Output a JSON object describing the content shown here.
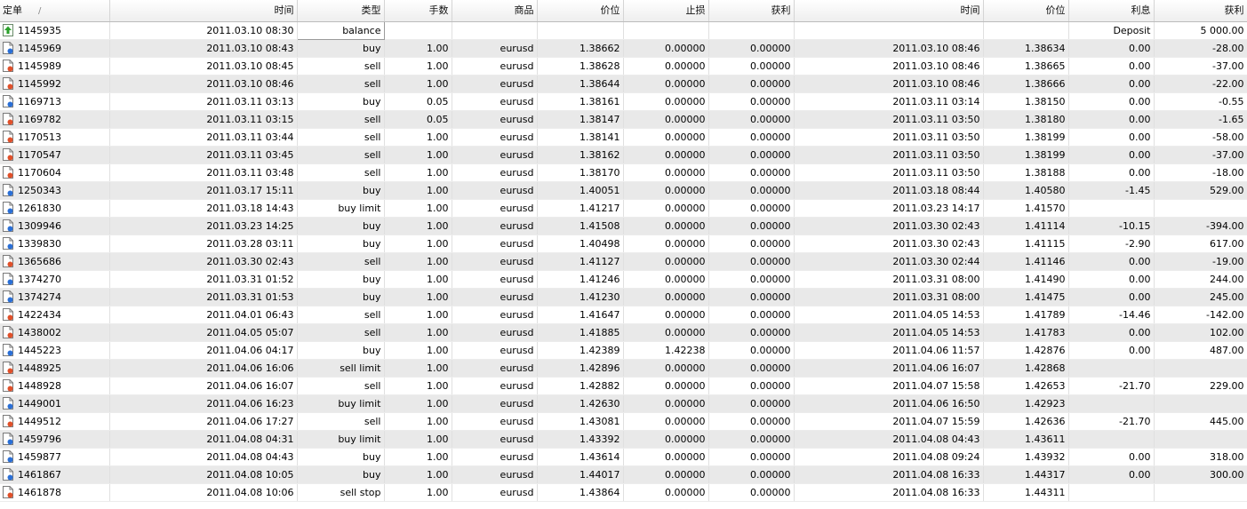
{
  "columns": [
    "定单",
    "时间",
    "类型",
    "手数",
    "商品",
    "价位",
    "止损",
    "获利",
    "时间",
    "价位",
    "利息",
    "获利"
  ],
  "sort_indicator": "/",
  "balance_row": {
    "order": "1145935",
    "time": "2011.03.10 08:30",
    "type": "balance",
    "comment": "Deposit",
    "amount": "5 000.00"
  },
  "rows": [
    {
      "order": "1145969",
      "open_time": "2011.03.10 08:43",
      "type": "buy",
      "lots": "1.00",
      "symbol": "eurusd",
      "open_price": "1.38662",
      "sl": "0.00000",
      "tp": "0.00000",
      "close_time": "2011.03.10 08:46",
      "close_price": "1.38634",
      "swap": "0.00",
      "profit": "-28.00",
      "icon": "buy"
    },
    {
      "order": "1145989",
      "open_time": "2011.03.10 08:45",
      "type": "sell",
      "lots": "1.00",
      "symbol": "eurusd",
      "open_price": "1.38628",
      "sl": "0.00000",
      "tp": "0.00000",
      "close_time": "2011.03.10 08:46",
      "close_price": "1.38665",
      "swap": "0.00",
      "profit": "-37.00",
      "icon": "sell"
    },
    {
      "order": "1145992",
      "open_time": "2011.03.10 08:46",
      "type": "sell",
      "lots": "1.00",
      "symbol": "eurusd",
      "open_price": "1.38644",
      "sl": "0.00000",
      "tp": "0.00000",
      "close_time": "2011.03.10 08:46",
      "close_price": "1.38666",
      "swap": "0.00",
      "profit": "-22.00",
      "icon": "sell"
    },
    {
      "order": "1169713",
      "open_time": "2011.03.11 03:13",
      "type": "buy",
      "lots": "0.05",
      "symbol": "eurusd",
      "open_price": "1.38161",
      "sl": "0.00000",
      "tp": "0.00000",
      "close_time": "2011.03.11 03:14",
      "close_price": "1.38150",
      "swap": "0.00",
      "profit": "-0.55",
      "icon": "buy"
    },
    {
      "order": "1169782",
      "open_time": "2011.03.11 03:15",
      "type": "sell",
      "lots": "0.05",
      "symbol": "eurusd",
      "open_price": "1.38147",
      "sl": "0.00000",
      "tp": "0.00000",
      "close_time": "2011.03.11 03:50",
      "close_price": "1.38180",
      "swap": "0.00",
      "profit": "-1.65",
      "icon": "sell"
    },
    {
      "order": "1170513",
      "open_time": "2011.03.11 03:44",
      "type": "sell",
      "lots": "1.00",
      "symbol": "eurusd",
      "open_price": "1.38141",
      "sl": "0.00000",
      "tp": "0.00000",
      "close_time": "2011.03.11 03:50",
      "close_price": "1.38199",
      "swap": "0.00",
      "profit": "-58.00",
      "icon": "sell"
    },
    {
      "order": "1170547",
      "open_time": "2011.03.11 03:45",
      "type": "sell",
      "lots": "1.00",
      "symbol": "eurusd",
      "open_price": "1.38162",
      "sl": "0.00000",
      "tp": "0.00000",
      "close_time": "2011.03.11 03:50",
      "close_price": "1.38199",
      "swap": "0.00",
      "profit": "-37.00",
      "icon": "sell"
    },
    {
      "order": "1170604",
      "open_time": "2011.03.11 03:48",
      "type": "sell",
      "lots": "1.00",
      "symbol": "eurusd",
      "open_price": "1.38170",
      "sl": "0.00000",
      "tp": "0.00000",
      "close_time": "2011.03.11 03:50",
      "close_price": "1.38188",
      "swap": "0.00",
      "profit": "-18.00",
      "icon": "sell"
    },
    {
      "order": "1250343",
      "open_time": "2011.03.17 15:11",
      "type": "buy",
      "lots": "1.00",
      "symbol": "eurusd",
      "open_price": "1.40051",
      "sl": "0.00000",
      "tp": "0.00000",
      "close_time": "2011.03.18 08:44",
      "close_price": "1.40580",
      "swap": "-1.45",
      "profit": "529.00",
      "icon": "buy"
    },
    {
      "order": "1261830",
      "open_time": "2011.03.18 14:43",
      "type": "buy limit",
      "lots": "1.00",
      "symbol": "eurusd",
      "open_price": "1.41217",
      "sl": "0.00000",
      "tp": "0.00000",
      "close_time": "2011.03.23 14:17",
      "close_price": "1.41570",
      "swap": "",
      "profit": "",
      "icon": "buy"
    },
    {
      "order": "1309946",
      "open_time": "2011.03.23 14:25",
      "type": "buy",
      "lots": "1.00",
      "symbol": "eurusd",
      "open_price": "1.41508",
      "sl": "0.00000",
      "tp": "0.00000",
      "close_time": "2011.03.30 02:43",
      "close_price": "1.41114",
      "swap": "-10.15",
      "profit": "-394.00",
      "icon": "buy"
    },
    {
      "order": "1339830",
      "open_time": "2011.03.28 03:11",
      "type": "buy",
      "lots": "1.00",
      "symbol": "eurusd",
      "open_price": "1.40498",
      "sl": "0.00000",
      "tp": "0.00000",
      "close_time": "2011.03.30 02:43",
      "close_price": "1.41115",
      "swap": "-2.90",
      "profit": "617.00",
      "icon": "buy"
    },
    {
      "order": "1365686",
      "open_time": "2011.03.30 02:43",
      "type": "sell",
      "lots": "1.00",
      "symbol": "eurusd",
      "open_price": "1.41127",
      "sl": "0.00000",
      "tp": "0.00000",
      "close_time": "2011.03.30 02:44",
      "close_price": "1.41146",
      "swap": "0.00",
      "profit": "-19.00",
      "icon": "sell"
    },
    {
      "order": "1374270",
      "open_time": "2011.03.31 01:52",
      "type": "buy",
      "lots": "1.00",
      "symbol": "eurusd",
      "open_price": "1.41246",
      "sl": "0.00000",
      "tp": "0.00000",
      "close_time": "2011.03.31 08:00",
      "close_price": "1.41490",
      "swap": "0.00",
      "profit": "244.00",
      "icon": "buy"
    },
    {
      "order": "1374274",
      "open_time": "2011.03.31 01:53",
      "type": "buy",
      "lots": "1.00",
      "symbol": "eurusd",
      "open_price": "1.41230",
      "sl": "0.00000",
      "tp": "0.00000",
      "close_time": "2011.03.31 08:00",
      "close_price": "1.41475",
      "swap": "0.00",
      "profit": "245.00",
      "icon": "buy"
    },
    {
      "order": "1422434",
      "open_time": "2011.04.01 06:43",
      "type": "sell",
      "lots": "1.00",
      "symbol": "eurusd",
      "open_price": "1.41647",
      "sl": "0.00000",
      "tp": "0.00000",
      "close_time": "2011.04.05 14:53",
      "close_price": "1.41789",
      "swap": "-14.46",
      "profit": "-142.00",
      "icon": "sell"
    },
    {
      "order": "1438002",
      "open_time": "2011.04.05 05:07",
      "type": "sell",
      "lots": "1.00",
      "symbol": "eurusd",
      "open_price": "1.41885",
      "sl": "0.00000",
      "tp": "0.00000",
      "close_time": "2011.04.05 14:53",
      "close_price": "1.41783",
      "swap": "0.00",
      "profit": "102.00",
      "icon": "sell"
    },
    {
      "order": "1445223",
      "open_time": "2011.04.06 04:17",
      "type": "buy",
      "lots": "1.00",
      "symbol": "eurusd",
      "open_price": "1.42389",
      "sl": "1.42238",
      "tp": "0.00000",
      "close_time": "2011.04.06 11:57",
      "close_price": "1.42876",
      "swap": "0.00",
      "profit": "487.00",
      "icon": "buy"
    },
    {
      "order": "1448925",
      "open_time": "2011.04.06 16:06",
      "type": "sell limit",
      "lots": "1.00",
      "symbol": "eurusd",
      "open_price": "1.42896",
      "sl": "0.00000",
      "tp": "0.00000",
      "close_time": "2011.04.06 16:07",
      "close_price": "1.42868",
      "swap": "",
      "profit": "",
      "icon": "sell"
    },
    {
      "order": "1448928",
      "open_time": "2011.04.06 16:07",
      "type": "sell",
      "lots": "1.00",
      "symbol": "eurusd",
      "open_price": "1.42882",
      "sl": "0.00000",
      "tp": "0.00000",
      "close_time": "2011.04.07 15:58",
      "close_price": "1.42653",
      "swap": "-21.70",
      "profit": "229.00",
      "icon": "sell"
    },
    {
      "order": "1449001",
      "open_time": "2011.04.06 16:23",
      "type": "buy limit",
      "lots": "1.00",
      "symbol": "eurusd",
      "open_price": "1.42630",
      "sl": "0.00000",
      "tp": "0.00000",
      "close_time": "2011.04.06 16:50",
      "close_price": "1.42923",
      "swap": "",
      "profit": "",
      "icon": "buy"
    },
    {
      "order": "1449512",
      "open_time": "2011.04.06 17:27",
      "type": "sell",
      "lots": "1.00",
      "symbol": "eurusd",
      "open_price": "1.43081",
      "sl": "0.00000",
      "tp": "0.00000",
      "close_time": "2011.04.07 15:59",
      "close_price": "1.42636",
      "swap": "-21.70",
      "profit": "445.00",
      "icon": "sell"
    },
    {
      "order": "1459796",
      "open_time": "2011.04.08 04:31",
      "type": "buy limit",
      "lots": "1.00",
      "symbol": "eurusd",
      "open_price": "1.43392",
      "sl": "0.00000",
      "tp": "0.00000",
      "close_time": "2011.04.08 04:43",
      "close_price": "1.43611",
      "swap": "",
      "profit": "",
      "icon": "buy"
    },
    {
      "order": "1459877",
      "open_time": "2011.04.08 04:43",
      "type": "buy",
      "lots": "1.00",
      "symbol": "eurusd",
      "open_price": "1.43614",
      "sl": "0.00000",
      "tp": "0.00000",
      "close_time": "2011.04.08 09:24",
      "close_price": "1.43932",
      "swap": "0.00",
      "profit": "318.00",
      "icon": "buy"
    },
    {
      "order": "1461867",
      "open_time": "2011.04.08 10:05",
      "type": "buy",
      "lots": "1.00",
      "symbol": "eurusd",
      "open_price": "1.44017",
      "sl": "0.00000",
      "tp": "0.00000",
      "close_time": "2011.04.08 16:33",
      "close_price": "1.44317",
      "swap": "0.00",
      "profit": "300.00",
      "icon": "buy"
    },
    {
      "order": "1461878",
      "open_time": "2011.04.08 10:06",
      "type": "sell stop",
      "lots": "1.00",
      "symbol": "eurusd",
      "open_price": "1.43864",
      "sl": "0.00000",
      "tp": "0.00000",
      "close_time": "2011.04.08 16:33",
      "close_price": "1.44311",
      "swap": "",
      "profit": "",
      "icon": "sell"
    }
  ],
  "colors": {
    "buy_dot": "#2a6fd6",
    "sell_dot": "#e0502a",
    "deposit_arrow": "#2aa02a"
  }
}
